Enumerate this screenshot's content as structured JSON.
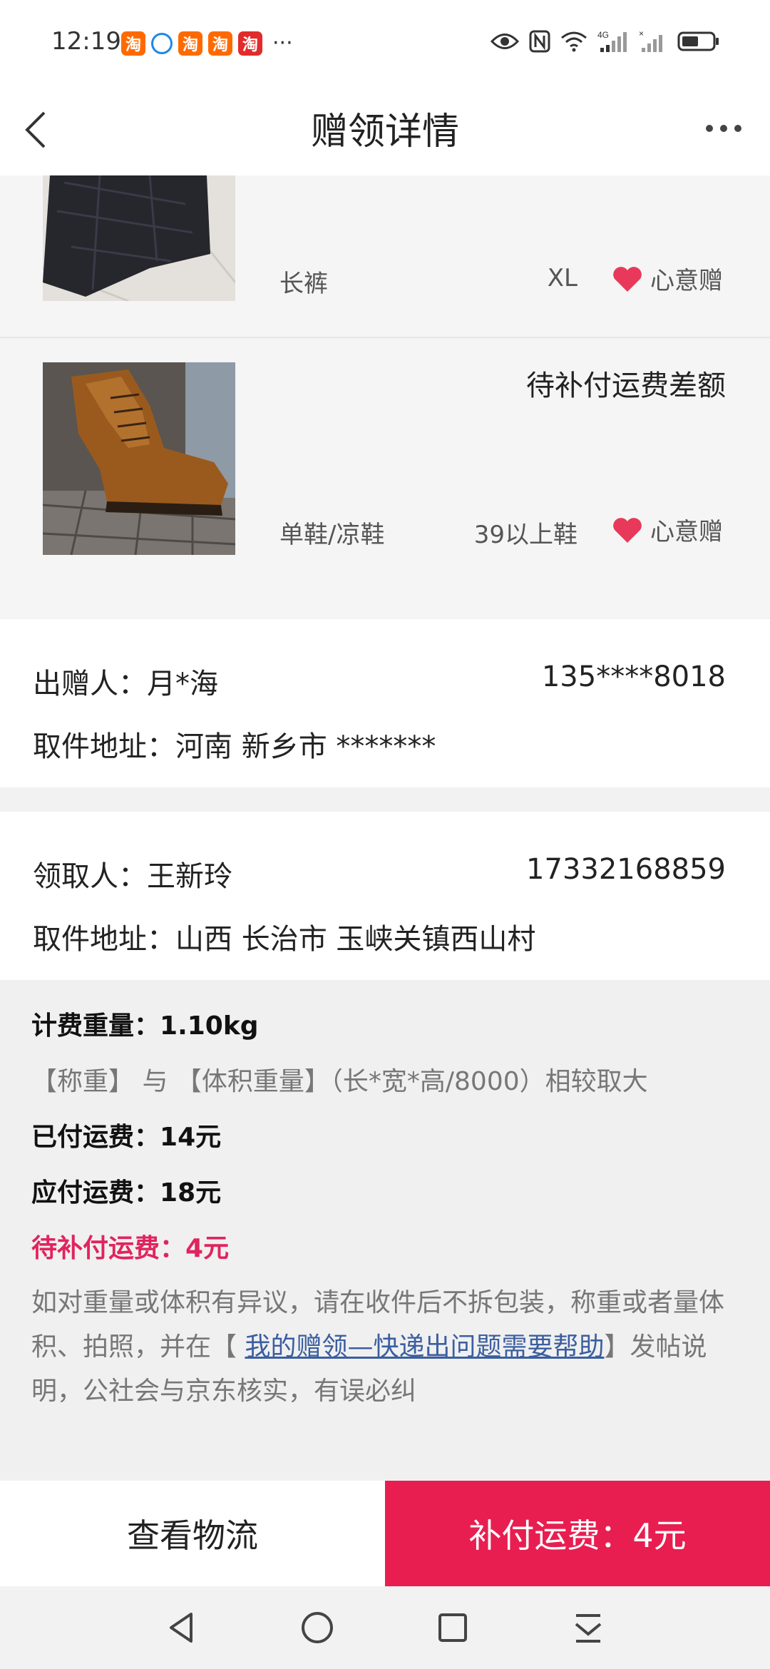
{
  "status_bar": {
    "time": "12:19",
    "app_icons": [
      "淘",
      "淘",
      "淘",
      "淘"
    ],
    "more": "···",
    "icons": [
      "eye-icon",
      "nfc-icon",
      "wifi-icon",
      "signal-4g-icon",
      "signal-icon",
      "battery-icon"
    ]
  },
  "header": {
    "title": "赠领详情"
  },
  "items": [
    {
      "category": "长裤",
      "size": "XL",
      "tag": "心意赠"
    },
    {
      "status": "待补付运费差额",
      "category": "单鞋/凉鞋",
      "size": "39以上鞋",
      "tag": "心意赠"
    }
  ],
  "giver": {
    "label": "出赠人：",
    "name": "月*海",
    "phone": "135****8018",
    "address_label": "取件地址：",
    "address": "河南 新乡市 *******"
  },
  "receiver": {
    "label": "领取人：",
    "name": "王新玲",
    "phone": "17332168859",
    "address_label": "取件地址：",
    "address": "山西 长治市 玉峡关镇西山村"
  },
  "fee": {
    "weight_label": "计费重量：",
    "weight": "1.10kg",
    "weight_rule": "【称重】 与 【体积重量】（长*宽*高/8000）相较取大",
    "paid_label": "已付运费：",
    "paid": "14元",
    "due_label": "应付运费：",
    "due": "18元",
    "pending_label": "待补付运费：",
    "pending": "4元",
    "note_before": "如对重量或体积有异议，请在收件后不拆包装，称重或者量体积、拍照，并在【 ",
    "note_link": "我的赠领—快递出问题需要帮助",
    "note_after": "】发帖说明，公社会与京东核实，有误必纠"
  },
  "actions": {
    "logistics": "查看物流",
    "pay": "补付运费：4元"
  },
  "colors": {
    "accent": "#e81e50",
    "heart": "#e8395a",
    "link": "#3b5ea0"
  }
}
